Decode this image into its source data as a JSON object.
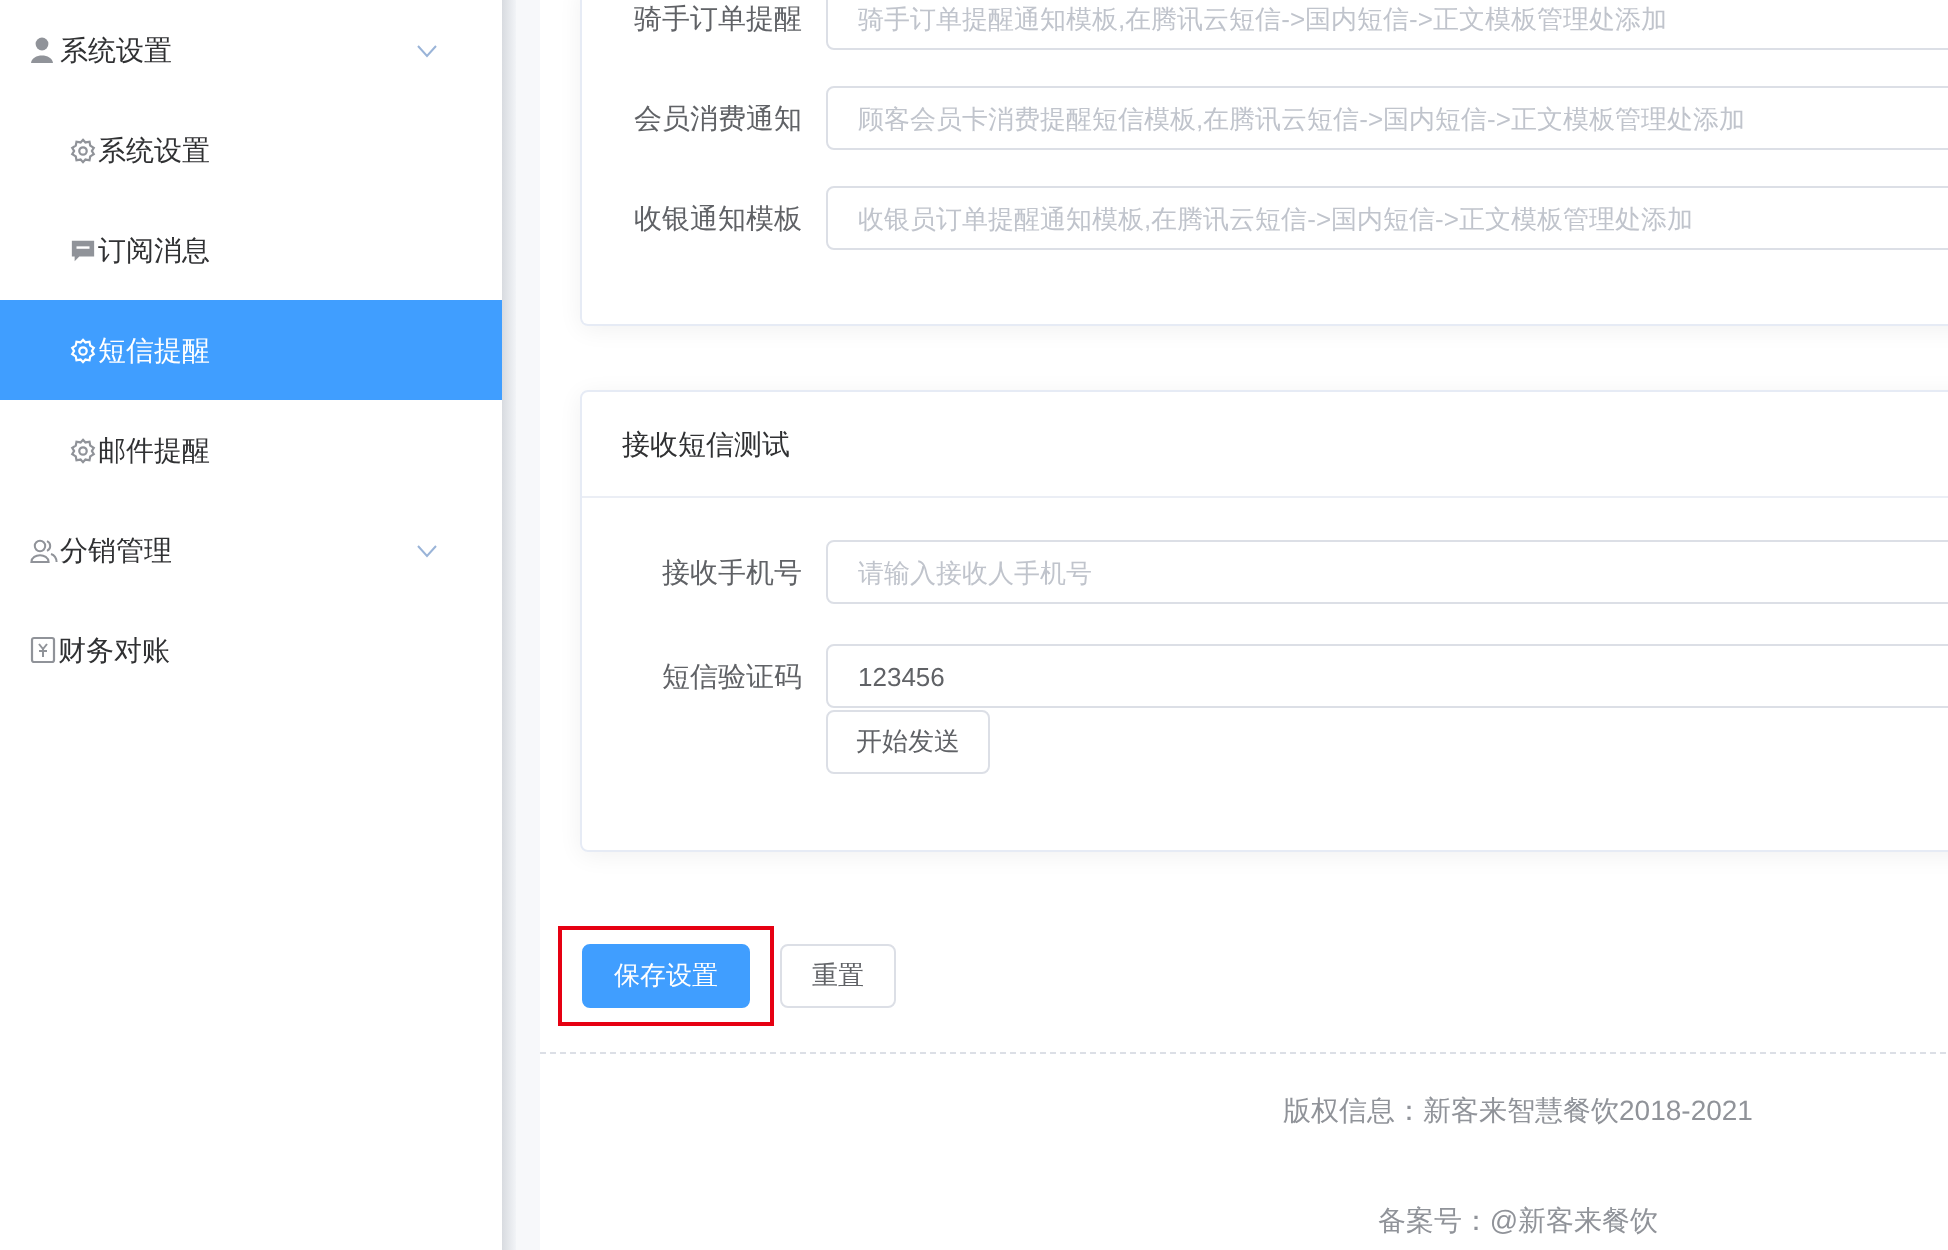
{
  "sidebar": {
    "items": [
      {
        "label": "系统设置",
        "kind": "group",
        "selected": false,
        "children": [
          {
            "label": "系统设置",
            "kind": "setting",
            "selected": false
          },
          {
            "label": "订阅消息",
            "kind": "message",
            "selected": false
          },
          {
            "label": "短信提醒",
            "kind": "setting",
            "selected": true
          },
          {
            "label": "邮件提醒",
            "kind": "setting",
            "selected": false
          }
        ]
      },
      {
        "label": "分销管理",
        "kind": "group",
        "selected": false
      },
      {
        "label": "财务对账",
        "kind": "link",
        "selected": false
      }
    ]
  },
  "template_card": {
    "rows": [
      {
        "label": "骑手订单提醒",
        "placeholder": "骑手订单提醒通知模板,在腾讯云短信->国内短信->正文模板管理处添加"
      },
      {
        "label": "会员消费通知",
        "placeholder": "顾客会员卡消费提醒短信模板,在腾讯云短信->国内短信->正文模板管理处添加"
      },
      {
        "label": "收银通知模板",
        "placeholder": "收银员订单提醒通知模板,在腾讯云短信->国内短信->正文模板管理处添加"
      }
    ]
  },
  "test_card": {
    "title": "接收短信测试",
    "rows": [
      {
        "label": "接收手机号",
        "placeholder": "请输入接收人手机号"
      },
      {
        "label": "短信验证码",
        "value": "123456"
      }
    ],
    "send_button": "开始发送"
  },
  "actions": [
    {
      "label": "保存设置",
      "kind": "primary",
      "highlighted": true
    },
    {
      "label": "重置",
      "kind": "default",
      "highlighted": false
    }
  ],
  "footer": {
    "copyright": "版权信息：新客来智慧餐饮2018-2021",
    "record": "备案号：@新客来餐饮"
  }
}
